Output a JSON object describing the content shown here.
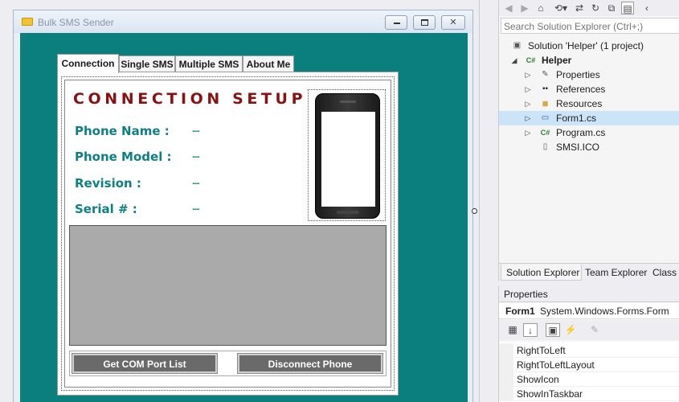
{
  "form": {
    "title": "Bulk SMS Sender",
    "controls": {
      "minimize": "minimize",
      "maximize": "maximize",
      "close": "close"
    }
  },
  "tabs": [
    {
      "label": "Connection",
      "active": true
    },
    {
      "label": "Single SMS",
      "active": false
    },
    {
      "label": "Multiple SMS",
      "active": false
    },
    {
      "label": "About Me",
      "active": false
    }
  ],
  "connection": {
    "title": "CONNECTION SETUP",
    "fields": [
      {
        "label": "Phone Name :",
        "value": "....."
      },
      {
        "label": "Phone Model :",
        "value": "....."
      },
      {
        "label": "Revision :",
        "value": "....."
      },
      {
        "label": "Serial # :",
        "value": "....."
      }
    ],
    "get_com_button": "Get COM Port List",
    "disconnect_button": "Disconnect Phone"
  },
  "solution_explorer": {
    "search_placeholder": "Search Solution Explorer (Ctrl+;)",
    "tree": [
      {
        "label": "Solution 'Helper' (1 project)",
        "icon": "solution-icon",
        "level": 0,
        "arrow": ""
      },
      {
        "label": "Helper",
        "icon": "csharp-project-icon",
        "level": 0,
        "arrow": "expanded"
      },
      {
        "label": "Properties",
        "icon": "wrench-icon",
        "level": 1,
        "arrow": "collapsed"
      },
      {
        "label": "References",
        "icon": "references-icon",
        "level": 1,
        "arrow": "collapsed"
      },
      {
        "label": "Resources",
        "icon": "folder-icon",
        "level": 1,
        "arrow": "collapsed"
      },
      {
        "label": "Form1.cs",
        "icon": "form-icon",
        "level": 1,
        "arrow": "collapsed",
        "selected": true
      },
      {
        "label": "Program.cs",
        "icon": "csharp-file-icon",
        "level": 1,
        "arrow": "collapsed"
      },
      {
        "label": "SMSI.ICO",
        "icon": "ico-file-icon",
        "level": 1,
        "arrow": ""
      }
    ],
    "bottom_tabs": [
      "Solution Explorer",
      "Team Explorer",
      "Class V"
    ]
  },
  "properties": {
    "header": "Properties",
    "object_name": "Form1",
    "object_type": "System.Windows.Forms.Form",
    "rows": [
      "RightToLeft",
      "RightToLeftLayout",
      "ShowIcon",
      "ShowInTaskbar"
    ]
  },
  "colors": {
    "form_background": "#0b7f7d",
    "title_red": "#8b1010",
    "label_teal": "#0e7f82",
    "selection": "#cce4f7"
  }
}
